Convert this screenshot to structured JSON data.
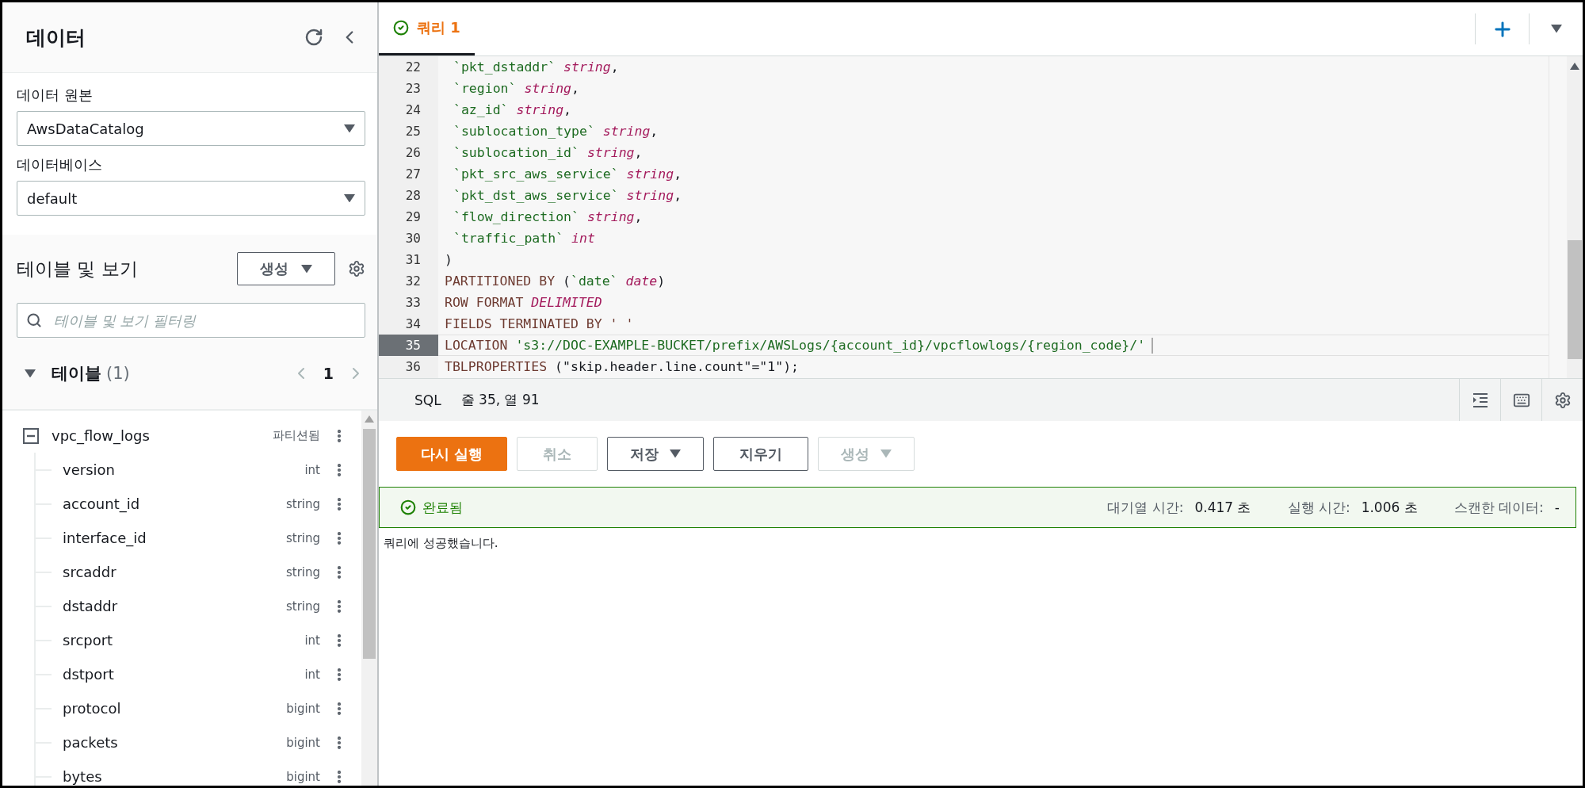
{
  "sidebar": {
    "title": "데이터",
    "data_source": {
      "label": "데이터 원본",
      "value": "AwsDataCatalog"
    },
    "database": {
      "label": "데이터베이스",
      "value": "default"
    },
    "tables_section": {
      "title": "테이블 및 보기",
      "create_button": "생성",
      "filter": {
        "placeholder": "테이블 및 보기 필터링"
      }
    },
    "tables_group": {
      "title": "테이블",
      "count": "(1)",
      "expanded": true,
      "page": "1"
    },
    "tree": [
      {
        "name": "vpc_flow_logs",
        "type": "파티션됨",
        "expanded": true,
        "children": [
          {
            "name": "version",
            "type": "int"
          },
          {
            "name": "account_id",
            "type": "string"
          },
          {
            "name": "interface_id",
            "type": "string"
          },
          {
            "name": "srcaddr",
            "type": "string"
          },
          {
            "name": "dstaddr",
            "type": "string"
          },
          {
            "name": "srcport",
            "type": "int"
          },
          {
            "name": "dstport",
            "type": "int"
          },
          {
            "name": "protocol",
            "type": "bigint"
          },
          {
            "name": "packets",
            "type": "bigint"
          },
          {
            "name": "bytes",
            "type": "bigint"
          }
        ]
      }
    ]
  },
  "tabs": [
    {
      "label": "쿼리 1",
      "selected": true
    }
  ],
  "editor": {
    "lines": [
      {
        "number": "22",
        "selected": false,
        "indent": true,
        "tokens": [
          {
            "t": "`pkt_dstaddr` ",
            "kind": "ident"
          },
          {
            "t": "string",
            "kind": "type"
          },
          {
            "t": ",",
            "kind": "punct"
          }
        ]
      },
      {
        "number": "23",
        "selected": false,
        "indent": true,
        "tokens": [
          {
            "t": "`region` ",
            "kind": "ident"
          },
          {
            "t": "string",
            "kind": "type"
          },
          {
            "t": ",",
            "kind": "punct"
          }
        ]
      },
      {
        "number": "24",
        "selected": false,
        "indent": true,
        "tokens": [
          {
            "t": "`az_id` ",
            "kind": "ident"
          },
          {
            "t": "string",
            "kind": "type"
          },
          {
            "t": ",",
            "kind": "punct"
          }
        ]
      },
      {
        "number": "25",
        "selected": false,
        "indent": true,
        "tokens": [
          {
            "t": "`sublocation_type` ",
            "kind": "ident"
          },
          {
            "t": "string",
            "kind": "type"
          },
          {
            "t": ",",
            "kind": "punct"
          }
        ]
      },
      {
        "number": "26",
        "selected": false,
        "indent": true,
        "tokens": [
          {
            "t": "`sublocation_id` ",
            "kind": "ident"
          },
          {
            "t": "string",
            "kind": "type"
          },
          {
            "t": ",",
            "kind": "punct"
          }
        ]
      },
      {
        "number": "27",
        "selected": false,
        "indent": true,
        "tokens": [
          {
            "t": "`pkt_src_aws_service` ",
            "kind": "ident"
          },
          {
            "t": "string",
            "kind": "type"
          },
          {
            "t": ",",
            "kind": "punct"
          }
        ]
      },
      {
        "number": "28",
        "selected": false,
        "indent": true,
        "tokens": [
          {
            "t": "`pkt_dst_aws_service` ",
            "kind": "ident"
          },
          {
            "t": "string",
            "kind": "type"
          },
          {
            "t": ",",
            "kind": "punct"
          }
        ]
      },
      {
        "number": "29",
        "selected": false,
        "indent": true,
        "tokens": [
          {
            "t": "`flow_direction` ",
            "kind": "ident"
          },
          {
            "t": "string",
            "kind": "type"
          },
          {
            "t": ",",
            "kind": "punct"
          }
        ]
      },
      {
        "number": "30",
        "selected": false,
        "indent": true,
        "tokens": [
          {
            "t": "`traffic_path` ",
            "kind": "ident"
          },
          {
            "t": "int",
            "kind": "type"
          }
        ]
      },
      {
        "number": "31",
        "selected": false,
        "indent": false,
        "tokens": [
          {
            "t": ")",
            "kind": "punct"
          }
        ]
      },
      {
        "number": "32",
        "selected": false,
        "indent": false,
        "tokens": [
          {
            "t": "PARTITIONED BY ",
            "kind": "keyword"
          },
          {
            "t": "(",
            "kind": "punct"
          },
          {
            "t": "`date` ",
            "kind": "ident"
          },
          {
            "t": "date",
            "kind": "type"
          },
          {
            "t": ")",
            "kind": "punct"
          }
        ]
      },
      {
        "number": "33",
        "selected": false,
        "indent": false,
        "tokens": [
          {
            "t": "ROW FORMAT ",
            "kind": "keyword"
          },
          {
            "t": "DELIMITED",
            "kind": "type"
          }
        ]
      },
      {
        "number": "34",
        "selected": false,
        "indent": false,
        "tokens": [
          {
            "t": "FIELDS TERMINATED BY ' '",
            "kind": "keyword"
          }
        ]
      },
      {
        "number": "35",
        "selected": true,
        "indent": false,
        "tokens": [
          {
            "t": "LOCATION ",
            "kind": "keyword"
          },
          {
            "t": "'s3://DOC-EXAMPLE-BUCKET/prefix/AWSLogs/{account_id}/vpcflowlogs/{region_code}/'",
            "kind": "ident"
          }
        ]
      },
      {
        "number": "36",
        "selected": false,
        "indent": false,
        "tokens": [
          {
            "t": "TBLPROPERTIES ",
            "kind": "keyword"
          },
          {
            "t": "(\"skip.header.line.count\"=\"1\");",
            "kind": "punct"
          }
        ]
      }
    ]
  },
  "status_bar": {
    "language": "SQL",
    "position": "줄 35, 열 91"
  },
  "actions": [
    {
      "label": "다시 실행",
      "kind": "primary",
      "disabled": false,
      "dropdown": false
    },
    {
      "label": "취소",
      "kind": "normal",
      "disabled": true,
      "dropdown": false
    },
    {
      "label": "저장",
      "kind": "normal",
      "disabled": false,
      "dropdown": true
    },
    {
      "label": "지우기",
      "kind": "normal",
      "disabled": false,
      "dropdown": false
    },
    {
      "label": "생성",
      "kind": "normal",
      "disabled": true,
      "dropdown": true
    }
  ],
  "result": {
    "status": "완료됨",
    "stats": [
      {
        "label": "대기열 시간:",
        "value": "0.417 초"
      },
      {
        "label": "실행 시간:",
        "value": "1.006 초"
      },
      {
        "label": "스캔한 데이터:",
        "value": "-"
      }
    ],
    "message": "쿼리에 성공했습니다."
  }
}
